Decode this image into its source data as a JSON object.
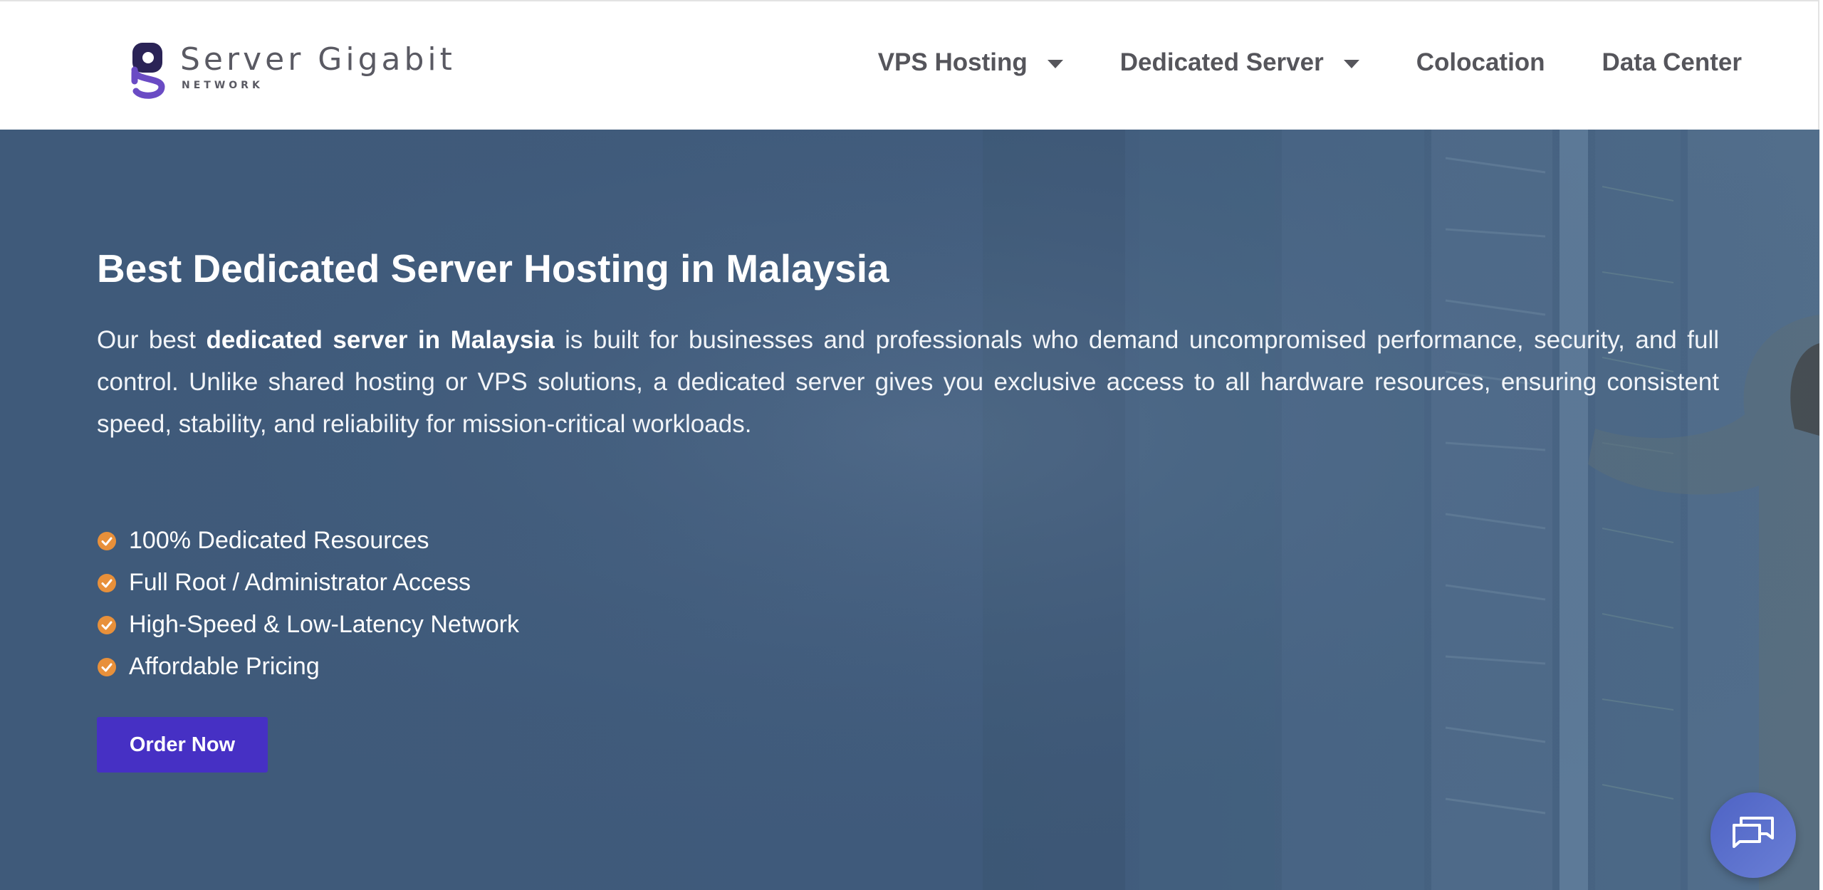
{
  "brand": {
    "name": "Server Gigabit",
    "tagline": "NETWORK",
    "logo_colors": [
      "#2a2356",
      "#6a4bc4"
    ]
  },
  "nav": {
    "items": [
      {
        "label": "VPS Hosting",
        "has_dropdown": true
      },
      {
        "label": "Dedicated Server",
        "has_dropdown": true
      },
      {
        "label": "Colocation",
        "has_dropdown": false
      },
      {
        "label": "Data Center",
        "has_dropdown": false
      }
    ]
  },
  "hero": {
    "title": "Best Dedicated Server Hosting in Malaysia",
    "desc_before": "Our best ",
    "desc_bold": "dedicated server in Malaysia",
    "desc_after": " is built for businesses and professionals who demand uncompromised performance, security, and full control. Unlike shared hosting or VPS solutions, a dedicated server gives you exclusive access to all hardware resources, ensuring consistent speed, stability, and reliability for mission-critical workloads.",
    "features": [
      "100% Dedicated Resources",
      "Full Root / Administrator Access",
      "High-Speed & Low-Latency Network",
      "Affordable Pricing"
    ],
    "cta_label": "Order Now",
    "background_image": "datacenter-technician-photo"
  },
  "icons": {
    "feature_bullet": "check-circle-icon",
    "chat": "chat-bubbles-icon"
  },
  "colors": {
    "hero_overlay": "#3f5a7a",
    "check": "#e8903a",
    "cta": "#4630c4",
    "nav_text": "#55555b",
    "chat_button": "#5a6fcd"
  }
}
